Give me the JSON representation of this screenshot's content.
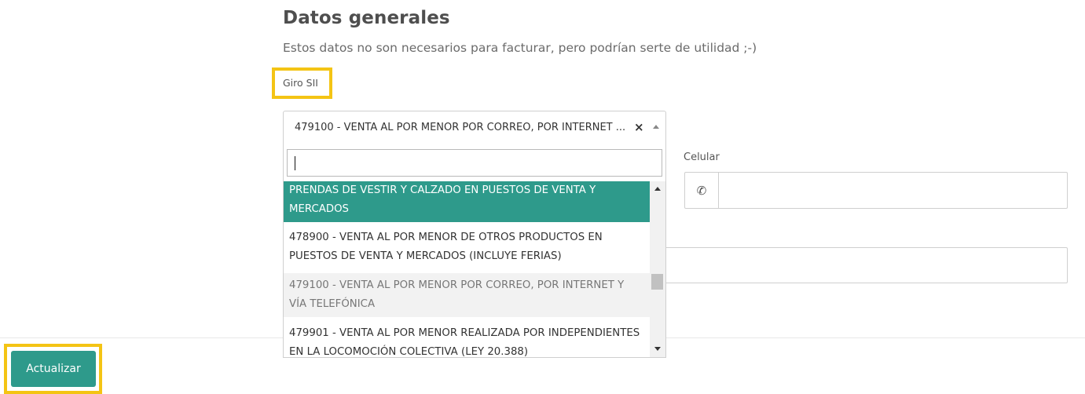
{
  "section": {
    "title": "Datos generales",
    "subtitle": "Estos datos no son necesarios para facturar, pero podrían serte de utilidad ;-)"
  },
  "giro": {
    "label": "Giro SII",
    "selected_value": "479100 - VENTA AL POR MENOR POR CORREO, POR INTERNET ...",
    "clear_symbol": "×",
    "search_value": "",
    "options": [
      {
        "line1": "PRENDAS DE VESTIR Y CALZADO EN PUESTOS DE VENTA Y",
        "line2": "MERCADOS",
        "state": "highlighted"
      },
      {
        "line1": "478900 - VENTA AL POR MENOR DE OTROS PRODUCTOS EN",
        "line2": "PUESTOS DE VENTA Y MERCADOS (INCLUYE FERIAS)",
        "state": "normal"
      },
      {
        "line1": "479100 - VENTA AL POR MENOR POR CORREO, POR INTERNET Y",
        "line2": "VÍA TELEFÓNICA",
        "state": "selected"
      },
      {
        "line1": "479901 - VENTA AL POR MENOR REALIZADA POR INDEPENDIENTES",
        "line2": "EN LA LOCOMOCIÓN COLECTIVA (LEY 20.388)",
        "state": "normal"
      }
    ]
  },
  "celular": {
    "label": "Celular",
    "value": ""
  },
  "actions": {
    "update_label": "Actualizar"
  },
  "colors": {
    "accent": "#2e9a8b",
    "highlight_outline": "#f4c414"
  }
}
